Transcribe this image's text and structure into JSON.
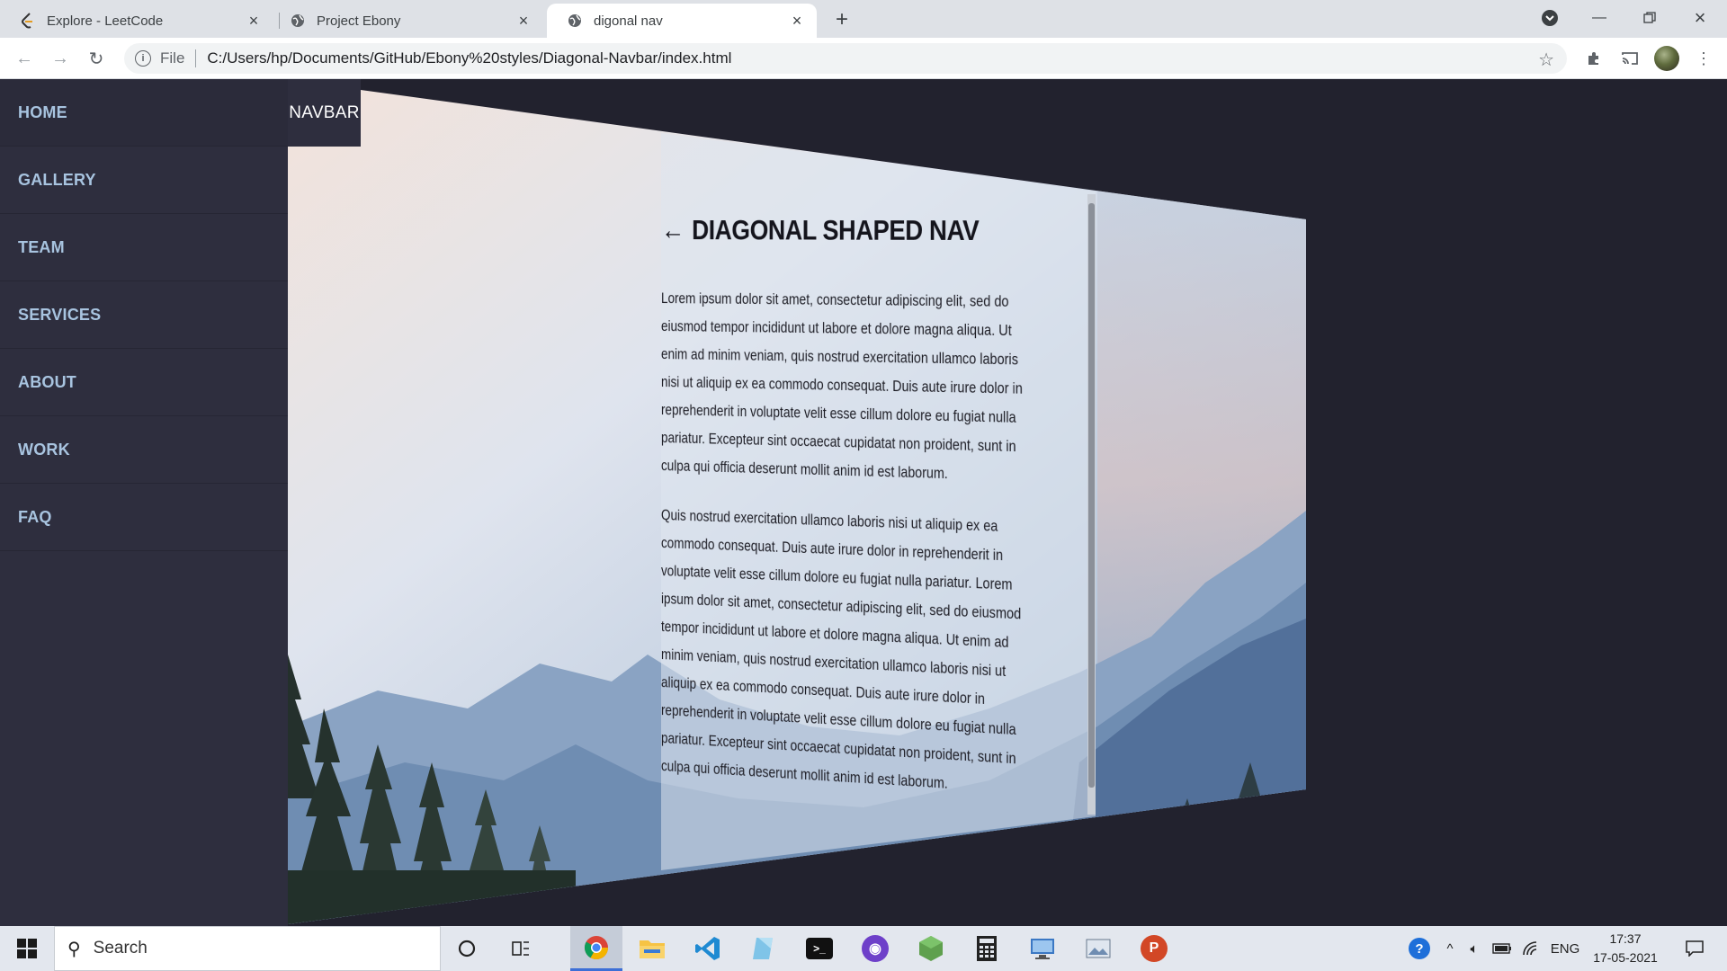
{
  "browser": {
    "tabs": [
      {
        "title": "Explore - LeetCode",
        "icon": "leetcode-icon"
      },
      {
        "title": "Project Ebony",
        "icon": "globe-icon"
      },
      {
        "title": "digonal nav",
        "icon": "globe-icon",
        "active": true
      }
    ],
    "address": {
      "scheme": "File",
      "url": "C:/Users/hp/Documents/GitHub/Ebony%20styles/Diagonal-Navbar/index.html"
    }
  },
  "page": {
    "navbar_label": "NAVBAR",
    "nav_items": [
      "HOME",
      "GALLERY",
      "TEAM",
      "SERVICES",
      "ABOUT",
      "WORK",
      "FAQ"
    ],
    "content": {
      "back_arrow": "←",
      "title": "DIAGONAL SHAPED NAV",
      "paragraph1": "Lorem ipsum dolor sit amet, consectetur adipiscing elit, sed do eiusmod tempor incididunt ut labore et dolore magna aliqua. Ut enim ad minim veniam, quis nostrud exercitation ullamco laboris nisi ut aliquip ex ea commodo consequat. Duis aute irure dolor in reprehenderit in voluptate velit esse cillum dolore eu fugiat nulla pariatur. Excepteur sint occaecat cupidatat non proident, sunt in culpa qui officia deserunt mollit anim id est laborum.",
      "paragraph2": "Quis nostrud exercitation ullamco laboris nisi ut aliquip ex ea commodo consequat. Duis aute irure dolor in reprehenderit in voluptate velit esse cillum dolore eu fugiat nulla pariatur. Lorem ipsum dolor sit amet, consectetur adipiscing elit, sed do eiusmod tempor incididunt ut labore et dolore magna aliqua. Ut enim ad minim veniam, quis nostrud exercitation ullamco laboris nisi ut aliquip ex ea commodo consequat. Duis aute irure dolor in reprehenderit in voluptate velit esse cillum dolore eu fugiat nulla pariatur. Excepteur sint occaecat cupidatat non proident, sunt in culpa qui officia deserunt mollit anim id est laborum."
    }
  },
  "taskbar": {
    "search_placeholder": "Search",
    "tray_language": "ENG",
    "time": "17:37",
    "date": "17-05-2021"
  },
  "colors": {
    "page_bg": "#22222e",
    "sidebar_bg": "#2e2e3e",
    "nav_text": "#a8c4e0"
  }
}
